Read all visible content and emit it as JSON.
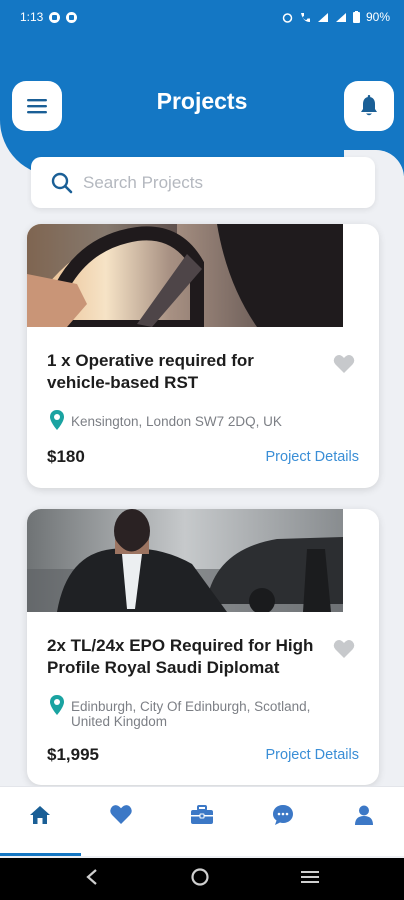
{
  "status_bar": {
    "time": "1:13",
    "battery": "90%"
  },
  "header": {
    "title": "Projects"
  },
  "search": {
    "placeholder": "Search Projects",
    "value": ""
  },
  "projects": [
    {
      "title_line1": "1 x Operative required for",
      "title_line2": "vehicle-based RST",
      "location": "Kensington, London SW7 2DQ, UK",
      "price": "$180",
      "details_label": "Project Details"
    },
    {
      "title_line1": "2x TL/24x EPO Required for High",
      "title_line2": "Profile Royal Saudi Diplomat",
      "location_line1": "Edinburgh, City Of Edinburgh, Scotland,",
      "location_line2": "United Kingdom",
      "price": "$1,995",
      "details_label": "Project Details"
    }
  ],
  "nav": {
    "items": [
      "home-icon",
      "heart-icon",
      "briefcase-icon",
      "chat-icon",
      "profile-icon"
    ],
    "active": "home"
  },
  "colors": {
    "primary": "#1477c4",
    "link": "#3a8ed6",
    "background": "#eef0f4",
    "heart": "#c7c9cc"
  }
}
